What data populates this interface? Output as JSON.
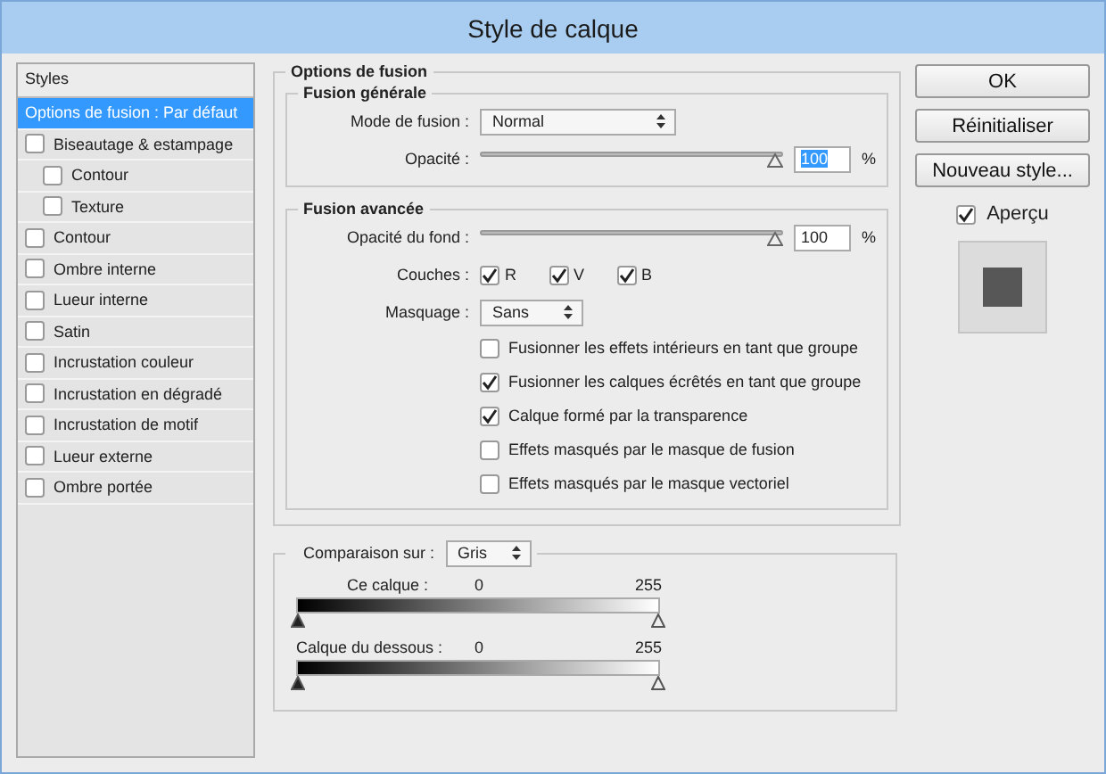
{
  "window": {
    "title": "Style de calque"
  },
  "styles_panel": {
    "header": "Styles",
    "items": [
      {
        "kind": "plain",
        "label": "Options de fusion : Par défaut",
        "selected": true
      },
      {
        "kind": "checkbox",
        "label": "Biseautage & estampage",
        "selected": false,
        "checked": false,
        "children": [
          {
            "kind": "checkbox",
            "label": "Contour",
            "selected": false,
            "checked": false
          },
          {
            "kind": "checkbox",
            "label": "Texture",
            "selected": false,
            "checked": false
          }
        ]
      },
      {
        "kind": "checkbox",
        "label": "Contour",
        "selected": false,
        "checked": false
      },
      {
        "kind": "checkbox",
        "label": "Ombre interne",
        "selected": false,
        "checked": false
      },
      {
        "kind": "checkbox",
        "label": "Lueur interne",
        "selected": false,
        "checked": false
      },
      {
        "kind": "checkbox",
        "label": "Satin",
        "selected": false,
        "checked": false
      },
      {
        "kind": "checkbox",
        "label": "Incrustation couleur",
        "selected": false,
        "checked": false
      },
      {
        "kind": "checkbox",
        "label": "Incrustation en dégradé",
        "selected": false,
        "checked": false
      },
      {
        "kind": "checkbox",
        "label": "Incrustation de motif",
        "selected": false,
        "checked": false
      },
      {
        "kind": "checkbox",
        "label": "Lueur externe",
        "selected": false,
        "checked": false
      },
      {
        "kind": "checkbox",
        "label": "Ombre portée",
        "selected": false,
        "checked": false
      }
    ]
  },
  "blending_options": {
    "title": "Options de fusion",
    "general": {
      "title": "Fusion générale",
      "blend_mode": {
        "label": "Mode de fusion :",
        "value": "Normal"
      },
      "opacity": {
        "label": "Opacité :",
        "level": 1,
        "value": "100",
        "highlighted": true,
        "unit": "%"
      }
    },
    "advanced": {
      "title": "Fusion avancée",
      "fill_opacity": {
        "label": "Opacité du fond :",
        "level": 1,
        "value": "100",
        "highlighted": false,
        "unit": "%"
      },
      "channels": {
        "label": "Couches :",
        "items": [
          {
            "label": "R",
            "checked": true
          },
          {
            "label": "V",
            "checked": true
          },
          {
            "label": "B",
            "checked": true
          }
        ]
      },
      "knockout": {
        "label": "Masquage :",
        "value": "Sans"
      },
      "options": [
        {
          "label": "Fusionner les effets intérieurs en tant que groupe",
          "checked": false
        },
        {
          "label": "Fusionner les calques écrêtés en tant que groupe",
          "checked": true
        },
        {
          "label": "Calque formé par la transparence",
          "checked": true
        },
        {
          "label": "Effets masqués par le masque de fusion",
          "checked": false
        },
        {
          "label": "Effets masqués par le masque vectoriel",
          "checked": false
        }
      ]
    }
  },
  "blend_if": {
    "label": "Comparaison sur :",
    "value": "Gris",
    "ramps": [
      {
        "label": "Ce calque :",
        "min": "0",
        "max": "255"
      },
      {
        "label": "Calque du dessous :",
        "min": "0",
        "max": "255"
      }
    ]
  },
  "buttons": [
    "OK",
    "Réinitialiser",
    "Nouveau style..."
  ],
  "preview": {
    "label": "Aperçu",
    "checked": true
  }
}
